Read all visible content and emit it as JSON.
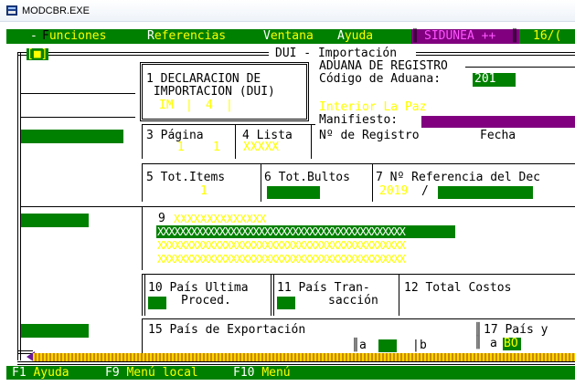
{
  "window": {
    "title": "MODCBR.EXE"
  },
  "menu": {
    "dash": "-",
    "items": [
      {
        "hot": "F",
        "rest": "unciones"
      },
      {
        "hot": "R",
        "rest": "eferencias"
      },
      {
        "hot": "V",
        "rest": "entana"
      },
      {
        "hot": "A",
        "rest": "yuda"
      }
    ],
    "system_name": "SIDUNEA ++",
    "date_fragment": "16/("
  },
  "frame": {
    "marker": "[■]",
    "title": "DUI - Importación"
  },
  "box1": {
    "line1": "1 DECLARACION DE",
    "line2": " IMPORTACION (DUI)",
    "type_code": "IM",
    "sep1": "|",
    "copy_number": "4",
    "sep2": "|"
  },
  "customs": {
    "heading": "ADUANA DE REGISTRO",
    "code_label": "Código de Aduana:",
    "code_value": "201",
    "office_name": "Interior La Paz",
    "manifest_label": "Manifiesto:",
    "registry_label": "Nº de Registro",
    "date_label": "Fecha"
  },
  "box3": {
    "label": "3 Página",
    "values": " 1    1"
  },
  "box4": {
    "label": "4 Lista",
    "values": "XXXXX"
  },
  "box5": {
    "label": "5 Tot.Items",
    "value": "1"
  },
  "box6": {
    "label": "6 Tot.Bultos"
  },
  "box7": {
    "label": "7 Nº Referencia del Dec",
    "year": "2019",
    "slash": "/"
  },
  "box9": {
    "label": "9",
    "line0": "XXXXXXXXXXXXXX",
    "line1": "XXXXXXXXXXXXXXXXXXXXXXXXXXXXXXXXXXXXXXXXXXXX",
    "line2": "XXXXXXXXXXXXXXXXXXXXXXXXXXXXXXXXXXXXXXXXXXXX",
    "line3": "XXXXXXXXXXXXXXXXXXXXXXXXXXXXXXXXXXXXXXXXXXXX"
  },
  "box10": {
    "line1": "10 País Ultima",
    "line2": "Proced."
  },
  "box11": {
    "line1": "11 País Tran-",
    "line2": "sacción"
  },
  "box12": {
    "label": "12 Total Costos"
  },
  "box15": {
    "label": "15 País de Exportación",
    "sub_a": "a",
    "sub_b": "b"
  },
  "box17": {
    "label": "17 País y",
    "sub_a": "a",
    "value": "BO"
  },
  "statusbar": {
    "items": [
      {
        "key": "F1",
        "label": "Ayuda"
      },
      {
        "key": "F9",
        "label": "Menú local"
      },
      {
        "key": "F10",
        "label": "Menú"
      }
    ]
  },
  "colors": {
    "dos_green": "#008000",
    "dos_yellow": "#ffff00",
    "dos_purple": "#800080",
    "dos_black": "#000000"
  }
}
